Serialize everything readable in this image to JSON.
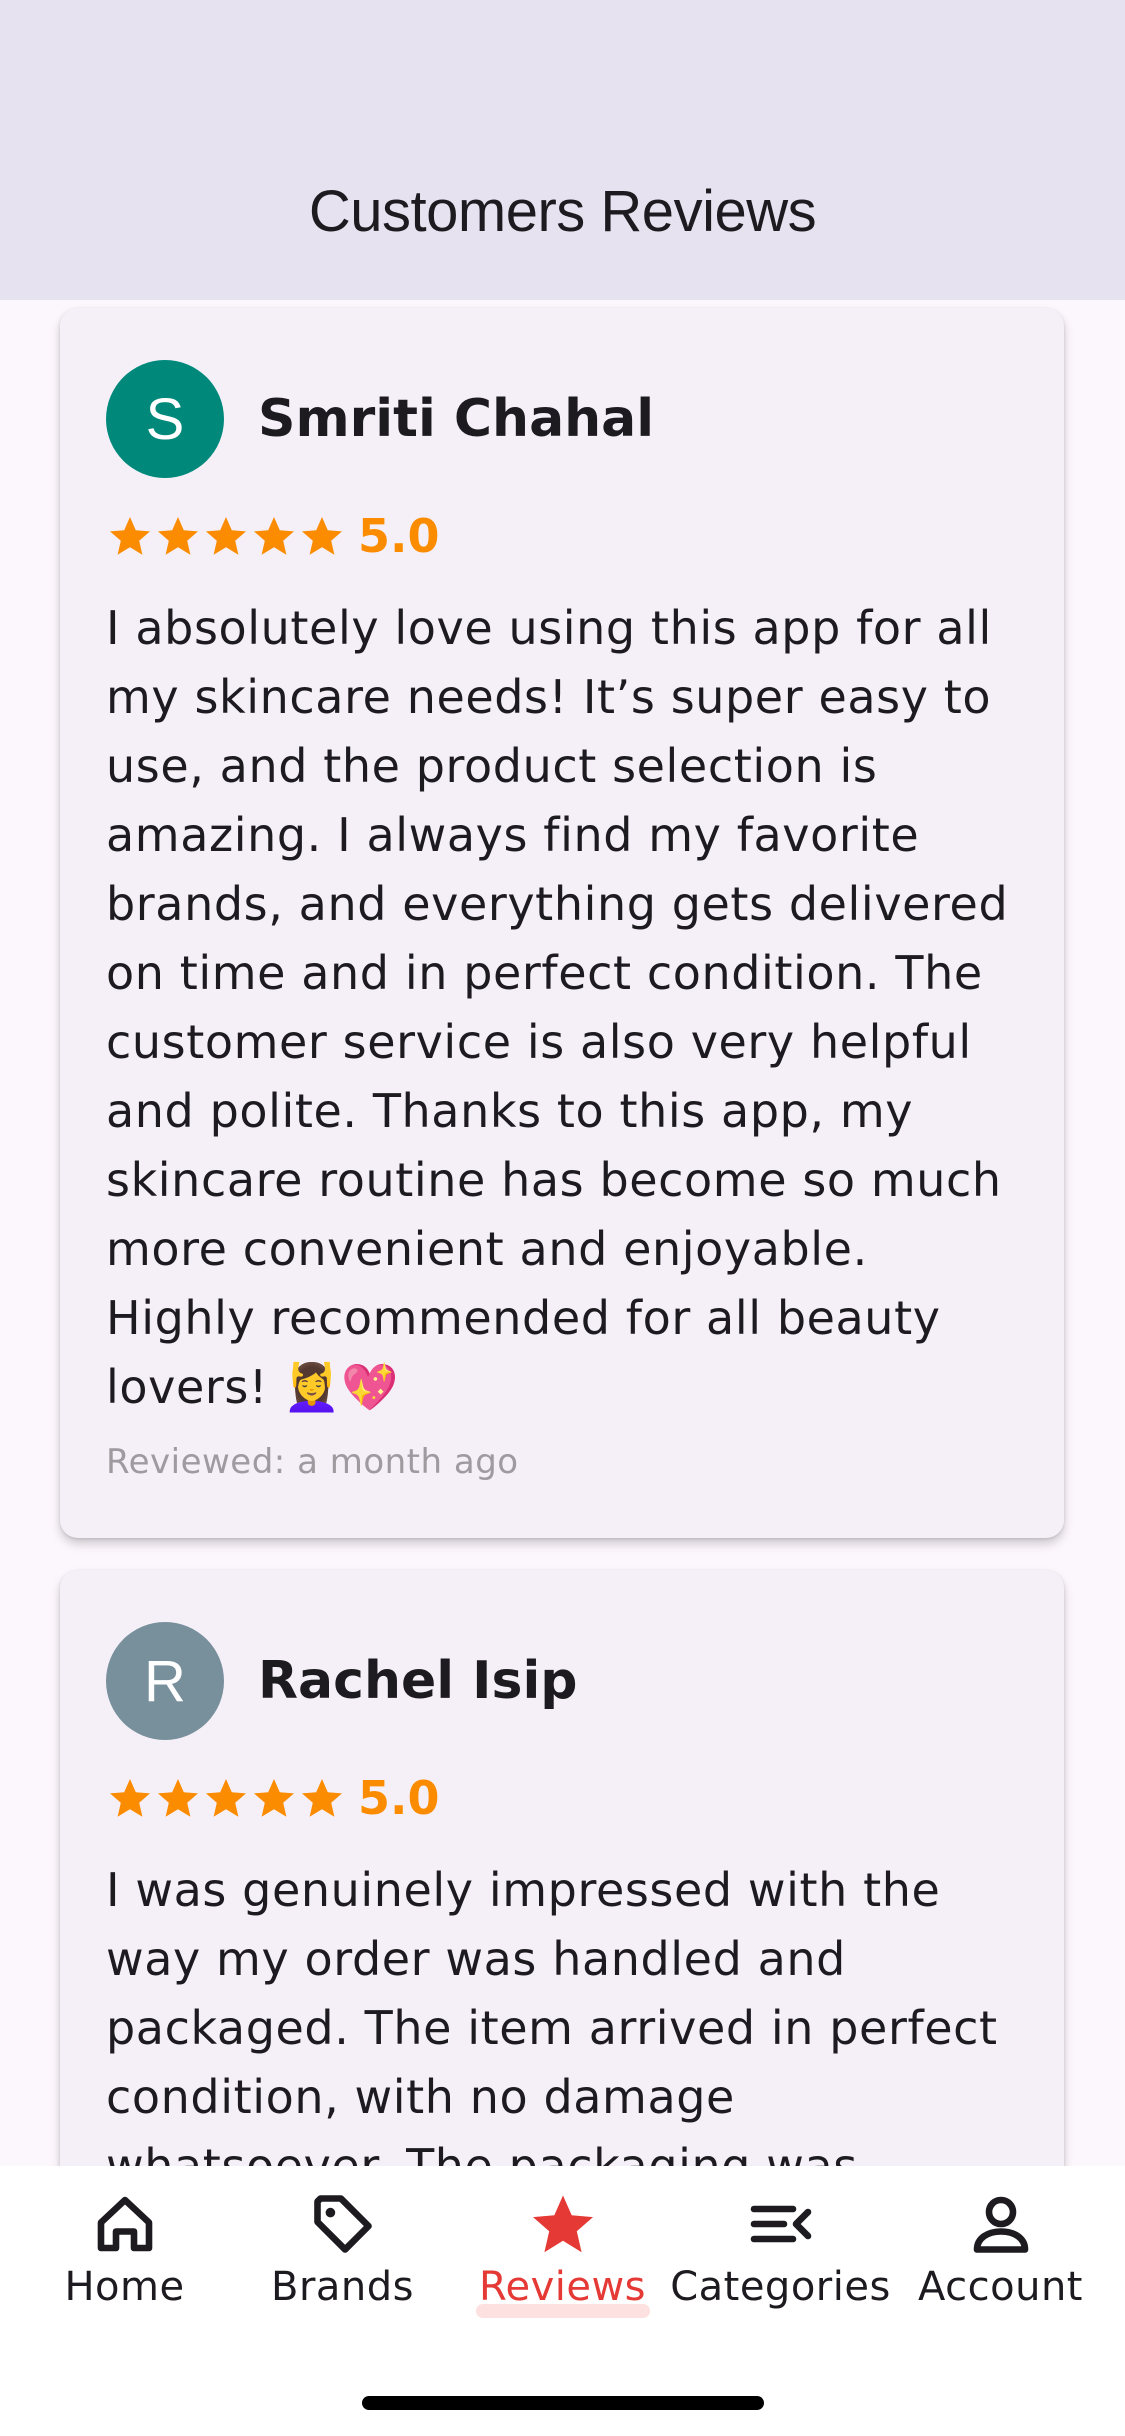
{
  "header": {
    "title": "Customers Reviews"
  },
  "reviews": [
    {
      "avatar_letter": "S",
      "avatar_color": "#00897b",
      "name": "Smriti Chahal",
      "rating": "5.0",
      "stars": 5,
      "text": "I absolutely love using this app for all my skincare needs! It’s super easy to use, and the product selection is amazing. I always find my favorite brands, and everything gets delivered on time and in perfect condition. The customer service is also very helpful and polite. Thanks to this app, my skincare routine has become so much more convenient and enjoyable. Highly recommended for all beauty lovers! 💆‍♀️💖",
      "reviewed": "Reviewed: a month ago"
    },
    {
      "avatar_letter": "R",
      "avatar_color": "#78909c",
      "name": "Rachel Isip",
      "rating": "5.0",
      "stars": 5,
      "text": "I was genuinely impressed with the way my order was handled and packaged. The item arrived in perfect condition, with no damage whatsoever. The packaging was secure, clean, and",
      "reviewed": ""
    }
  ],
  "nav": {
    "items": [
      {
        "label": "Home",
        "icon": "home-icon"
      },
      {
        "label": "Brands",
        "icon": "tag-icon"
      },
      {
        "label": "Reviews",
        "icon": "star-icon",
        "active": true
      },
      {
        "label": "Categories",
        "icon": "sort-list-icon"
      },
      {
        "label": "Account",
        "icon": "person-icon"
      }
    ]
  },
  "colors": {
    "star": "#fb8c00",
    "accent": "#e53935",
    "header_bg": "#e7e2ef"
  }
}
